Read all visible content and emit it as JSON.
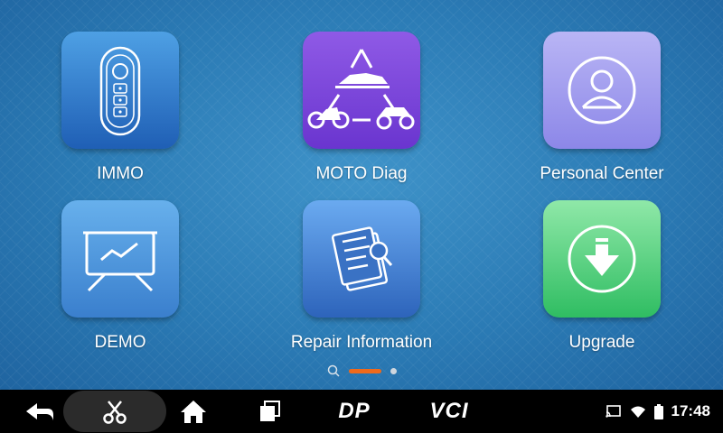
{
  "apps": [
    {
      "label": "IMMO",
      "icon": "key-fob-icon"
    },
    {
      "label": "MOTO Diag",
      "icon": "motorcycle-snowmobile-atv-icon"
    },
    {
      "label": "Personal Center",
      "icon": "user-profile-icon"
    },
    {
      "label": "DEMO",
      "icon": "presentation-chart-icon"
    },
    {
      "label": "Repair Information",
      "icon": "documents-search-icon"
    },
    {
      "label": "Upgrade",
      "icon": "download-arrow-icon"
    }
  ],
  "pager": {
    "pages": 2,
    "current": 1
  },
  "navbar": {
    "dp_label": "DP",
    "vci_label": "VCI"
  },
  "status": {
    "time": "17:48"
  },
  "colors": {
    "accent": "#f06a1b",
    "immo": "#1f5fb5",
    "moto": "#6a35cf",
    "personal": "#8c87e8",
    "demo": "#3a7fcd",
    "repair": "#2d64bb",
    "upgrade": "#2fbd62"
  }
}
